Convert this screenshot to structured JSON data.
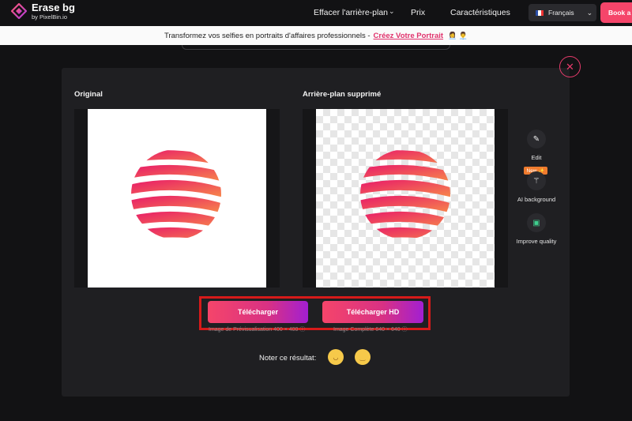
{
  "nav": {
    "brand_title": "Erase bg",
    "brand_sub": "by PixelBin.io",
    "links": [
      "Effacer l'arrière-plan",
      "Prix",
      "Caractéristiques"
    ],
    "language": "Français",
    "book_label": "Book a"
  },
  "announcement": {
    "text": "Transformez vos selfies en portraits d'affaires professionnels -",
    "link": "Créez Votre Portrait",
    "emoji": "👩‍💼 👨‍💼"
  },
  "modal": {
    "close_symbol": "✕",
    "original_label": "Original",
    "removed_label": "Arrière-plan supprimé",
    "tools": [
      {
        "label": "Edit",
        "icon": "pencil-icon"
      },
      {
        "label": "AI background",
        "icon": "magic-wand-icon",
        "badge": "New ✨"
      },
      {
        "label": "Improve quality",
        "icon": "enhance-icon"
      }
    ],
    "download": {
      "label": "Télécharger",
      "caption": "Image de Prévisualisation 400 × 400 ⓘ"
    },
    "download_hd": {
      "label": "Télécharger HD",
      "caption": "Image Complète 640 × 640 ⓘ"
    },
    "rate_label": "Noter ce résultat:"
  },
  "colors": {
    "accent": "#f5456a",
    "highlight_border": "#d71a1a"
  }
}
